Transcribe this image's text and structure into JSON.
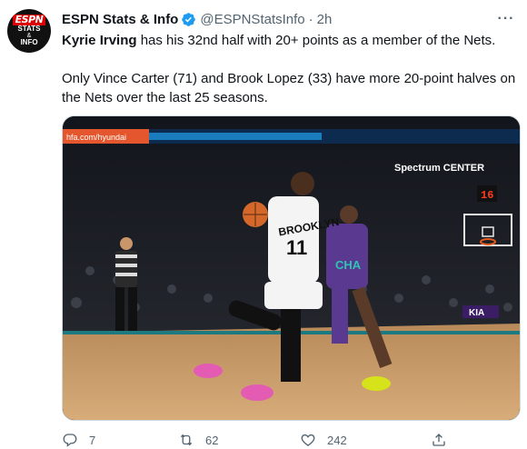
{
  "tweet": {
    "display_name": "ESPN Stats & Info",
    "handle": "@ESPNStatsInfo",
    "separator": "·",
    "time": "2h",
    "more_label": "···",
    "avatar": {
      "brand": "ESPN",
      "line1": "STATS",
      "amp": "&",
      "line2": "INFO"
    },
    "text": {
      "mention": "Kyrie Irving",
      "line1_rest": " has his 32nd half with 20+ points as a member of the Nets.",
      "paragraph2": "Only Vince Carter (71) and Brook Lopez (33) have more 20-point halves on the Nets over the last 25 seasons."
    },
    "media": {
      "arena_sign": "Spectrum CENTER",
      "ribbon_left": "hfa.com/hyundai",
      "shot_clock": "16",
      "jersey_home": "BROOKLYN",
      "jersey_number": "11",
      "jersey_away": "CHA",
      "court_logo": "KIA"
    },
    "actions": {
      "replies": "7",
      "retweets": "62",
      "likes": "242"
    }
  },
  "colors": {
    "verified": "#1d9bf0",
    "secondary_text": "#536471",
    "primary_text": "#0f1419"
  }
}
